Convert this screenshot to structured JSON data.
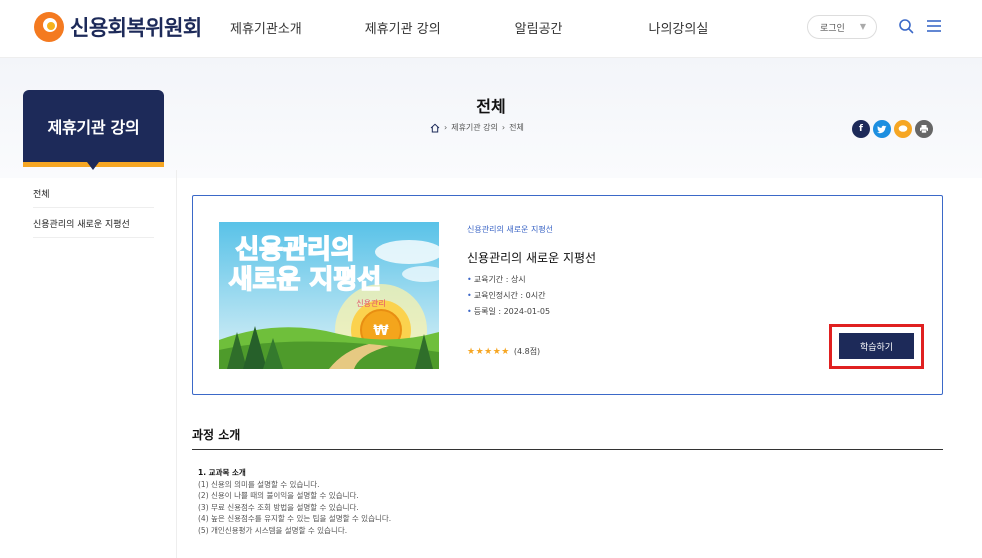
{
  "header": {
    "logo_text": "신용회복위원회",
    "nav": [
      "제휴기관소개",
      "제휴기관 강의",
      "알림공간",
      "나의강의실"
    ],
    "login_label": "로그인",
    "accent": "#1d2a59",
    "brand_orange": "#f47a20"
  },
  "sidebar": {
    "title": "제휴기관 강의",
    "items": [
      "전체",
      "신용관리의 새로운 지평선"
    ]
  },
  "page": {
    "title": "전체",
    "breadcrumb": [
      "제휴기관 강의",
      "전체"
    ],
    "share_icons": [
      "facebook-icon",
      "twitter-icon",
      "message-icon",
      "print-icon"
    ]
  },
  "course": {
    "thumb_text_line1": "신용관리의",
    "thumb_text_line2": "새로운 지평선",
    "thumb_badge": "신용관리",
    "category": "신용관리의 새로운 지평선",
    "title": "신용관리의 새로운 지평선",
    "meta": [
      "교육기간 : 상시",
      "교육인정시간 : 0시간",
      "등록일 : 2024-01-05"
    ],
    "stars": "★★★★★",
    "rating": "(4.8점)",
    "button": "학습하기"
  },
  "intro": {
    "title": "과정 소개",
    "heading": "1. 교과목 소개",
    "lines": [
      "(1) 신용의 의미를 설명할 수 있습니다.",
      "(2) 신용이 나쁠 때의 불이익을 설명할 수 있습니다.",
      "(3) 무료 신용점수 조회 방법을 설명할 수 있습니다.",
      "(4) 높은 신용점수를 유지할 수 있는 팁을 설명할 수 있습니다.",
      "(5) 개인신용평가 시스템을 설명할 수 있습니다."
    ]
  }
}
